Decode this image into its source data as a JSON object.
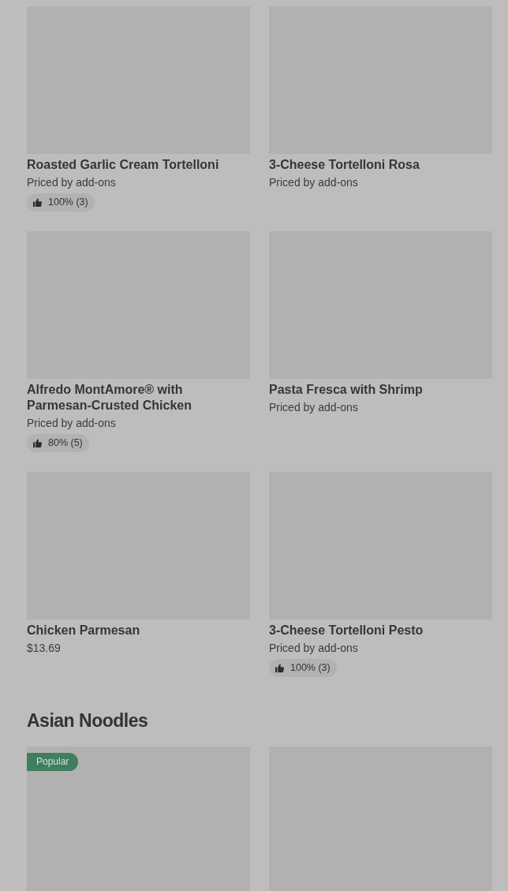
{
  "sections": [
    {
      "items": [
        {
          "name": "Roasted Garlic Cream Tortelloni",
          "price": "Priced by add-ons",
          "rating": "100% (3)"
        },
        {
          "name": "3-Cheese Tortelloni Rosa",
          "price": "Priced by add-ons"
        },
        {
          "name": "Alfredo MontAmore® with Parmesan-Crusted Chicken",
          "price": "Priced by add-ons",
          "rating": "80% (5)"
        },
        {
          "name": "Pasta Fresca with Shrimp",
          "price": "Priced by add-ons"
        },
        {
          "name": "Chicken Parmesan",
          "price": "$13.69"
        },
        {
          "name": "3-Cheese Tortelloni Pesto",
          "price": "Priced by add-ons",
          "rating": "100% (3)"
        }
      ]
    },
    {
      "title": "Asian Noodles",
      "items": [
        {
          "popular": true,
          "badge": "Popular"
        },
        {
          "popular": false
        }
      ]
    }
  ]
}
